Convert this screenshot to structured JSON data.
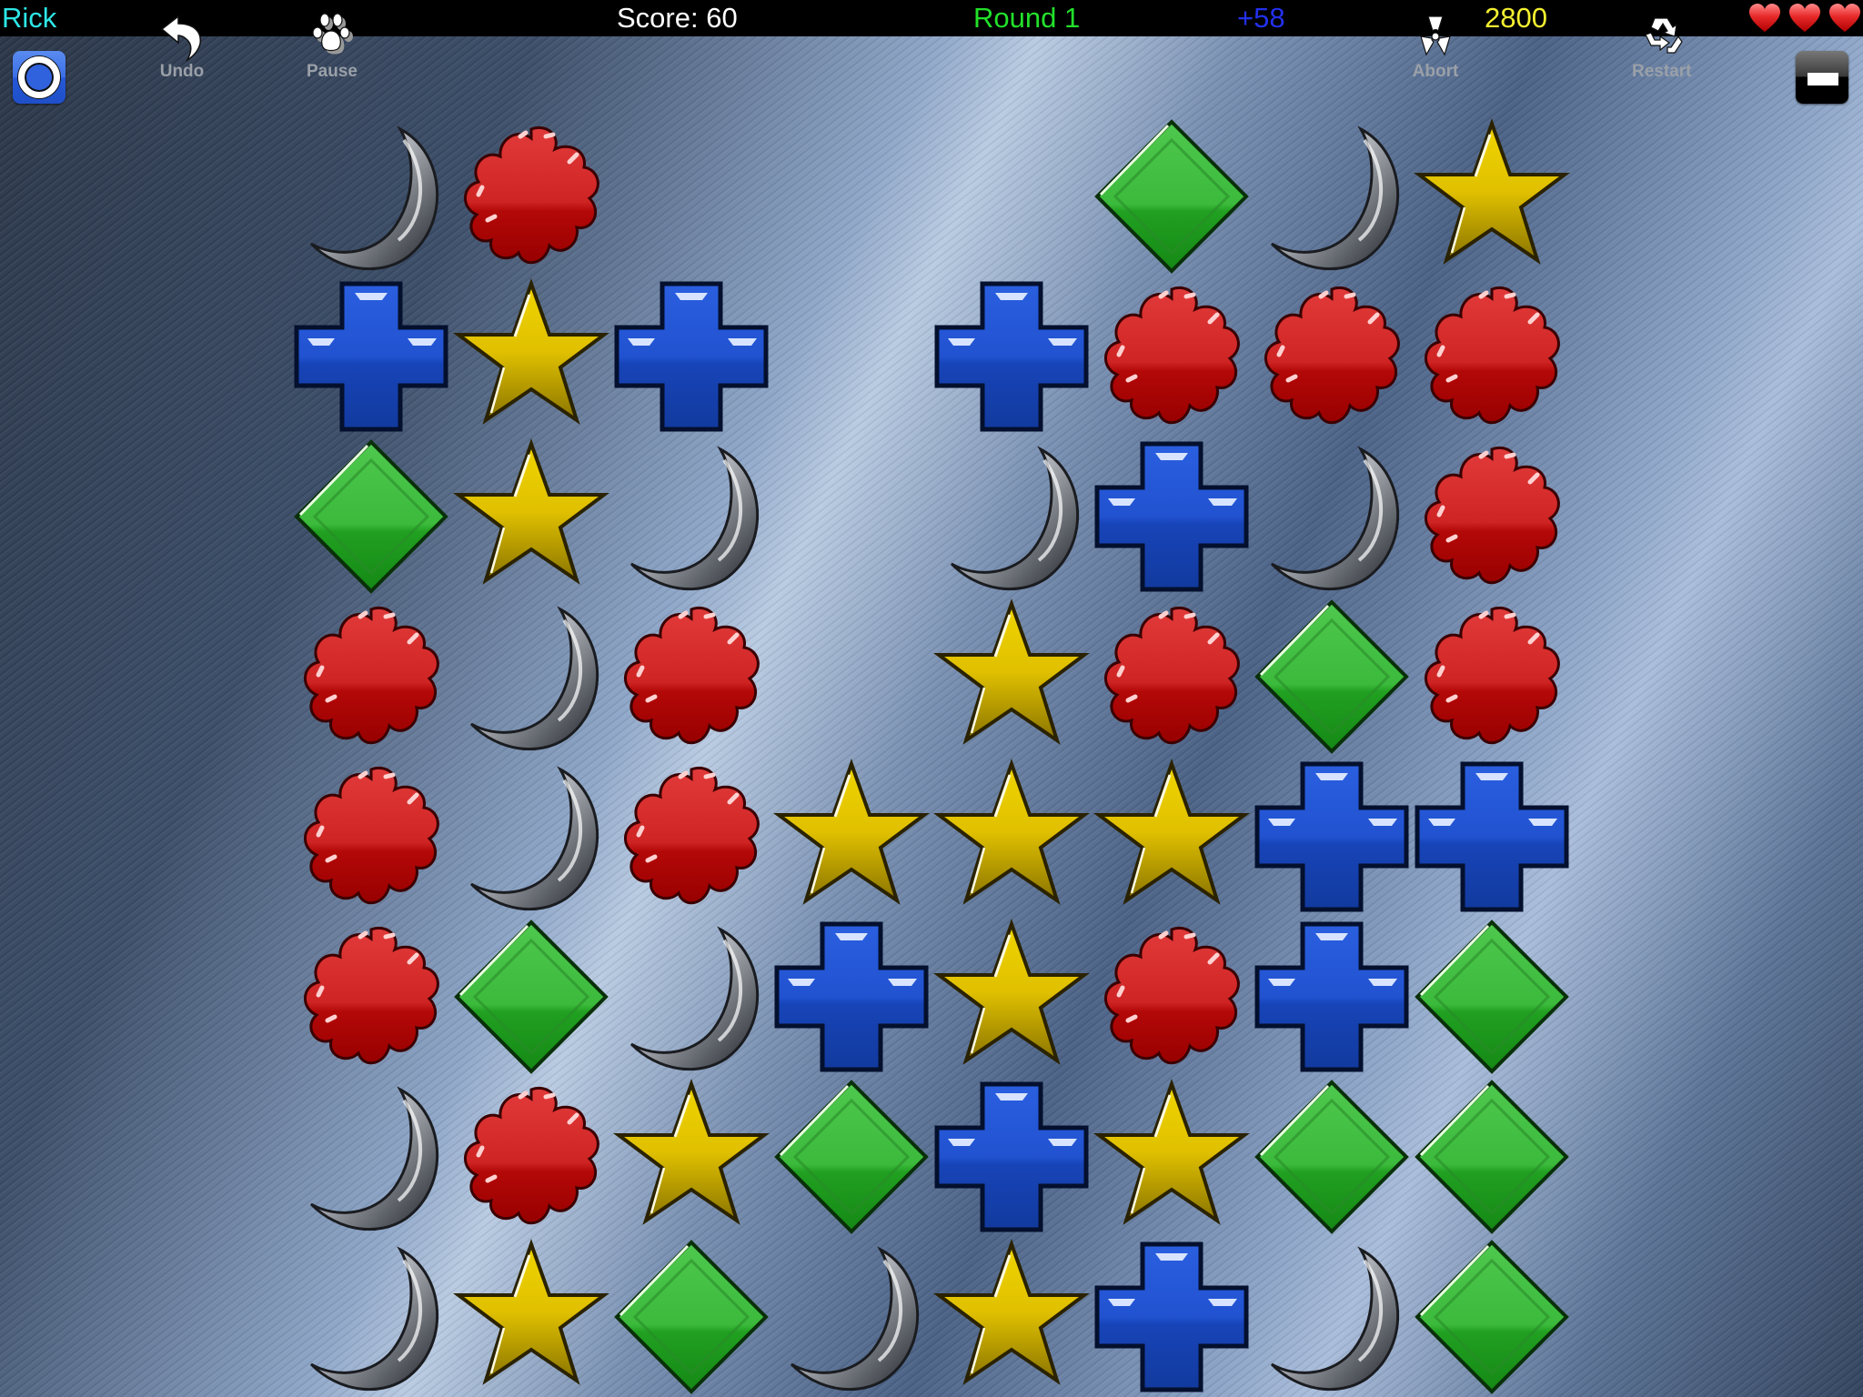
{
  "status": {
    "player": "Rick",
    "score": "Score: 60",
    "round": "Round 1",
    "bonus": "+58",
    "target": "2800",
    "lives": 3
  },
  "toolbar": {
    "undo_label": "Undo",
    "pause_label": "Pause",
    "abort_label": "Abort",
    "restart_label": "Restart"
  },
  "colors": {
    "player": "#2ee6e6",
    "score": "#ffffff",
    "round": "#22e02a",
    "bonus": "#2230ee",
    "target": "#f4f030",
    "moon": "#b8bcc2",
    "flower": "#d42a2a",
    "cross": "#1f4fd0",
    "star": "#e6c800",
    "diamond": "#2eb82e"
  },
  "board": {
    "columns": 8,
    "rows": 8,
    "cells": [
      [
        "moon",
        "flower",
        "empty",
        "empty",
        "empty",
        "diamond",
        "moon",
        "star"
      ],
      [
        "cross",
        "star",
        "cross",
        "empty",
        "cross",
        "flower",
        "flower",
        "flower"
      ],
      [
        "diamond",
        "star",
        "moon",
        "empty",
        "moon",
        "cross",
        "moon",
        "flower"
      ],
      [
        "flower",
        "moon",
        "flower",
        "empty",
        "star",
        "flower",
        "diamond",
        "flower"
      ],
      [
        "flower",
        "moon",
        "flower",
        "star",
        "star",
        "star",
        "cross",
        "cross"
      ],
      [
        "flower",
        "diamond",
        "moon",
        "cross",
        "star",
        "flower",
        "cross",
        "diamond"
      ],
      [
        "moon",
        "flower",
        "star",
        "diamond",
        "cross",
        "star",
        "diamond",
        "diamond"
      ],
      [
        "moon",
        "star",
        "diamond",
        "moon",
        "star",
        "cross",
        "moon",
        "diamond"
      ]
    ]
  }
}
